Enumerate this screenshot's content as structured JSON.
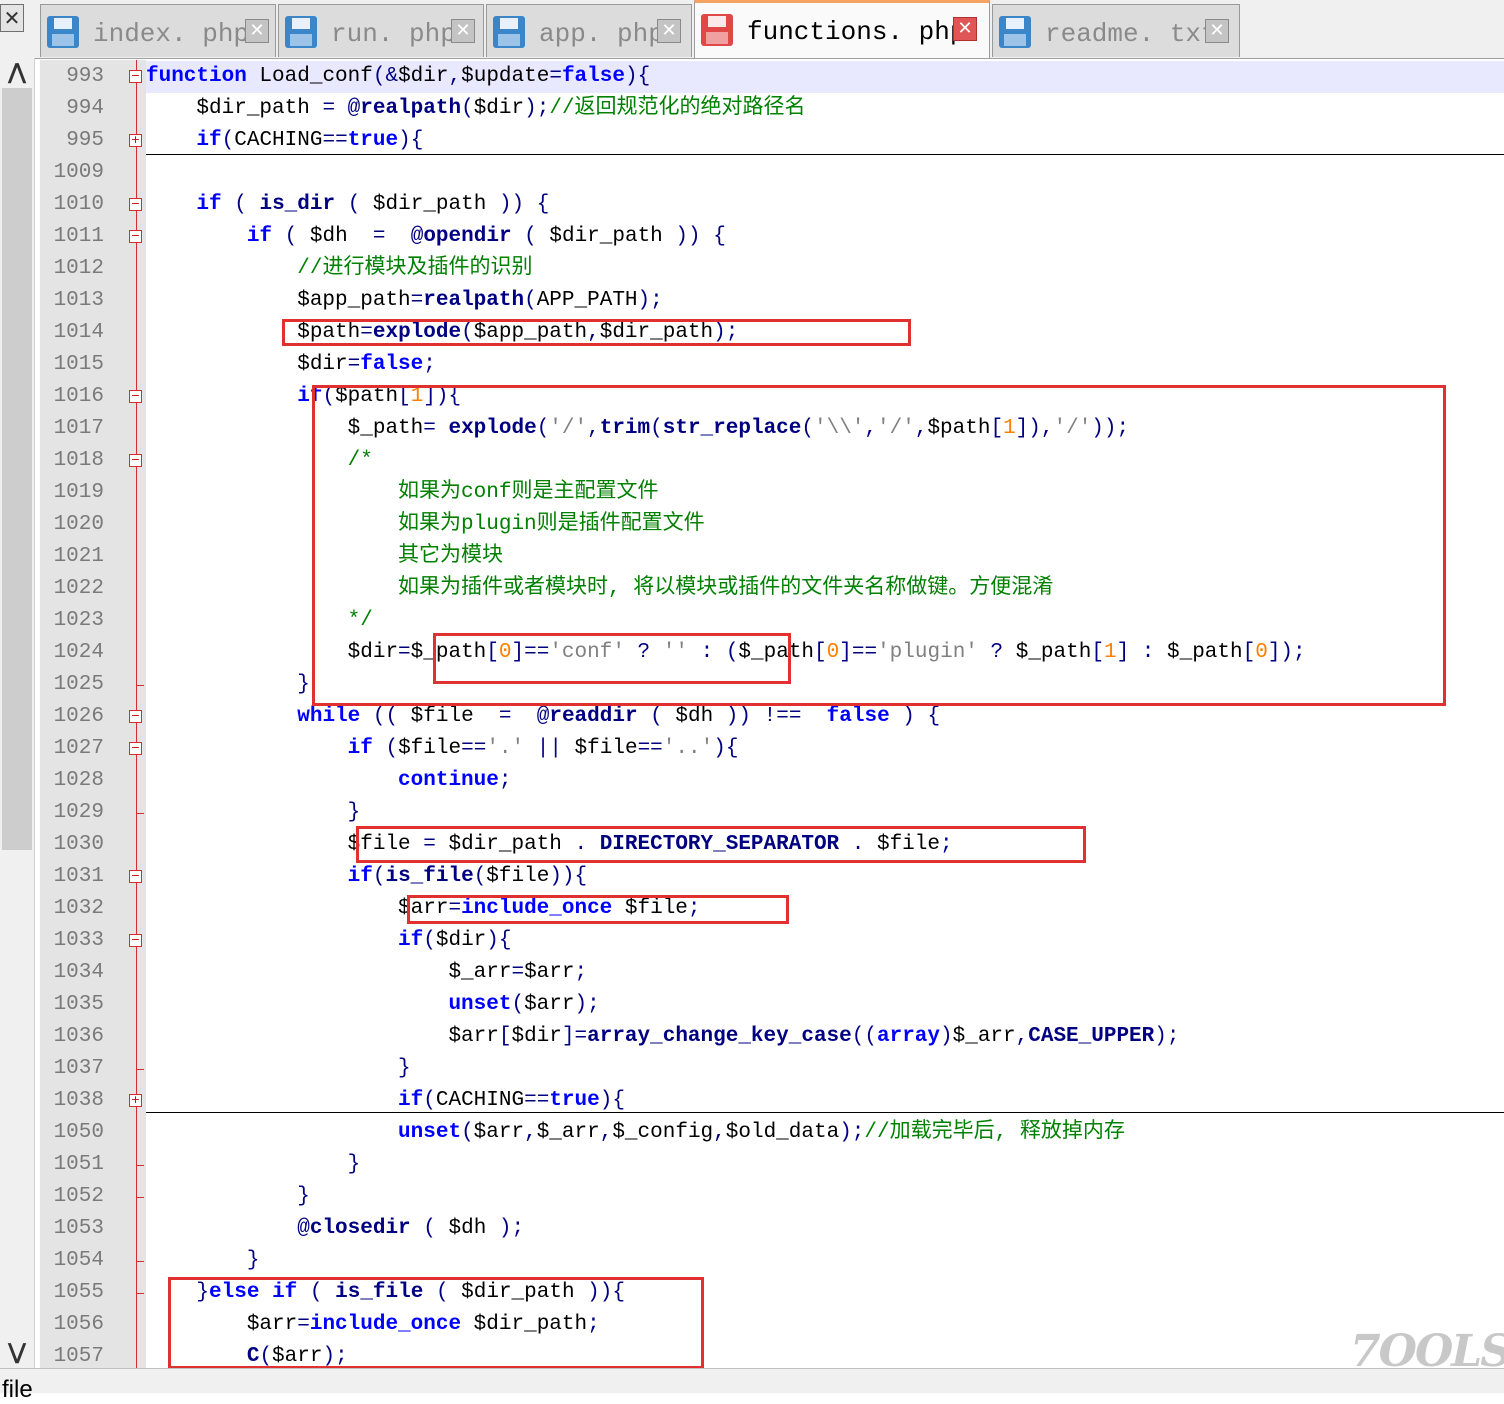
{
  "tabs": [
    {
      "label": "index. php",
      "active": false
    },
    {
      "label": "run. php",
      "active": false
    },
    {
      "label": "app. php",
      "active": false
    },
    {
      "label": "functions. php",
      "active": true
    },
    {
      "label": "readme. txt",
      "active": false
    }
  ],
  "close_glyph": "✕",
  "scroll_up_glyph": "⋀",
  "scroll_down_glyph": "⋁",
  "status_text": "file",
  "watermark": "7OOLS",
  "colors": {
    "keyword": "#0000ff",
    "function": "#000080",
    "comment": "#008000",
    "number": "#ff8000",
    "string": "#808080",
    "annotation": "#e03030"
  },
  "lines": [
    {
      "num": "993",
      "fold": "box",
      "tokens": [
        [
          "k",
          "function"
        ],
        [
          "v",
          " Load_conf"
        ],
        [
          "o",
          "(&"
        ],
        [
          "v",
          "$dir"
        ],
        [
          "o",
          ","
        ],
        [
          "v",
          "$update"
        ],
        [
          "o",
          "="
        ],
        [
          "k",
          "false"
        ],
        [
          "o",
          ")"
        ],
        [
          "o",
          "{"
        ]
      ]
    },
    {
      "num": "994",
      "tokens": [
        [
          "v",
          "    $dir_path "
        ],
        [
          "o",
          "="
        ],
        [
          "v",
          " "
        ],
        [
          "o",
          "@"
        ],
        [
          "f",
          "realpath"
        ],
        [
          "o",
          "("
        ],
        [
          "v",
          "$dir"
        ],
        [
          "o",
          ");"
        ],
        [
          "c",
          "//返回规范化的绝对路径名"
        ]
      ]
    },
    {
      "num": "995",
      "fold": "plus",
      "tokens": [
        [
          "v",
          "    "
        ],
        [
          "k",
          "if"
        ],
        [
          "o",
          "("
        ],
        [
          "v",
          "CACHING"
        ],
        [
          "o",
          "=="
        ],
        [
          "k",
          "true"
        ],
        [
          "o",
          ")"
        ],
        [
          "o",
          "{"
        ]
      ]
    },
    {
      "num": "1009",
      "tokens": []
    },
    {
      "num": "1010",
      "fold": "box",
      "tokens": [
        [
          "v",
          "    "
        ],
        [
          "k",
          "if"
        ],
        [
          "v",
          " "
        ],
        [
          "o",
          "("
        ],
        [
          "v",
          " "
        ],
        [
          "f",
          "is_dir"
        ],
        [
          "v",
          " "
        ],
        [
          "o",
          "("
        ],
        [
          "v",
          " $dir_path "
        ],
        [
          "o",
          "))"
        ],
        [
          "v",
          " "
        ],
        [
          "o",
          "{"
        ]
      ]
    },
    {
      "num": "1011",
      "fold": "box",
      "tokens": [
        [
          "v",
          "        "
        ],
        [
          "k",
          "if"
        ],
        [
          "v",
          " "
        ],
        [
          "o",
          "("
        ],
        [
          "v",
          " $dh  "
        ],
        [
          "o",
          "="
        ],
        [
          "v",
          "  "
        ],
        [
          "o",
          "@"
        ],
        [
          "f",
          "opendir"
        ],
        [
          "v",
          " "
        ],
        [
          "o",
          "("
        ],
        [
          "v",
          " $dir_path "
        ],
        [
          "o",
          "))"
        ],
        [
          "v",
          " "
        ],
        [
          "o",
          "{"
        ]
      ]
    },
    {
      "num": "1012",
      "tokens": [
        [
          "v",
          "            "
        ],
        [
          "c",
          "//进行模块及插件的识别"
        ]
      ]
    },
    {
      "num": "1013",
      "tokens": [
        [
          "v",
          "            $app_path"
        ],
        [
          "o",
          "="
        ],
        [
          "f",
          "realpath"
        ],
        [
          "o",
          "("
        ],
        [
          "v",
          "APP_PATH"
        ],
        [
          "o",
          ");"
        ]
      ]
    },
    {
      "num": "1014",
      "tokens": [
        [
          "v",
          "            $path"
        ],
        [
          "o",
          "="
        ],
        [
          "f",
          "explode"
        ],
        [
          "o",
          "("
        ],
        [
          "v",
          "$app_path"
        ],
        [
          "o",
          ","
        ],
        [
          "v",
          "$dir_path"
        ],
        [
          "o",
          ");"
        ]
      ]
    },
    {
      "num": "1015",
      "tokens": [
        [
          "v",
          "            $dir"
        ],
        [
          "o",
          "="
        ],
        [
          "k",
          "false"
        ],
        [
          "o",
          ";"
        ]
      ]
    },
    {
      "num": "1016",
      "fold": "box",
      "tokens": [
        [
          "v",
          "            "
        ],
        [
          "k",
          "if"
        ],
        [
          "o",
          "("
        ],
        [
          "v",
          "$path"
        ],
        [
          "o",
          "["
        ],
        [
          "n",
          "1"
        ],
        [
          "o",
          "])"
        ],
        [
          "o",
          "{"
        ]
      ]
    },
    {
      "num": "1017",
      "tokens": [
        [
          "v",
          "                $_path"
        ],
        [
          "o",
          "="
        ],
        [
          "v",
          " "
        ],
        [
          "f",
          "explode"
        ],
        [
          "o",
          "("
        ],
        [
          "s",
          "'/'"
        ],
        [
          "o",
          ","
        ],
        [
          "f",
          "trim"
        ],
        [
          "o",
          "("
        ],
        [
          "f",
          "str_replace"
        ],
        [
          "o",
          "("
        ],
        [
          "s",
          "'\\\\'"
        ],
        [
          "o",
          ","
        ],
        [
          "s",
          "'/'"
        ],
        [
          "o",
          ","
        ],
        [
          "v",
          "$path"
        ],
        [
          "o",
          "["
        ],
        [
          "n",
          "1"
        ],
        [
          "o",
          "]),"
        ],
        [
          "s",
          "'/'"
        ],
        [
          "o",
          "));"
        ]
      ]
    },
    {
      "num": "1018",
      "fold": "box",
      "tokens": [
        [
          "v",
          "                "
        ],
        [
          "c",
          "/*"
        ]
      ]
    },
    {
      "num": "1019",
      "tokens": [
        [
          "c",
          "                    如果为conf则是主配置文件"
        ]
      ]
    },
    {
      "num": "1020",
      "tokens": [
        [
          "c",
          "                    如果为plugin则是插件配置文件"
        ]
      ]
    },
    {
      "num": "1021",
      "tokens": [
        [
          "c",
          "                    其它为模块"
        ]
      ]
    },
    {
      "num": "1022",
      "tokens": [
        [
          "c",
          "                    如果为插件或者模块时, 将以模块或插件的文件夹名称做键。方便混淆"
        ]
      ]
    },
    {
      "num": "1023",
      "tokens": [
        [
          "c",
          "                */"
        ]
      ]
    },
    {
      "num": "1024",
      "tokens": [
        [
          "v",
          "                $dir"
        ],
        [
          "o",
          "="
        ],
        [
          "v",
          "$_path"
        ],
        [
          "o",
          "["
        ],
        [
          "n",
          "0"
        ],
        [
          "o",
          "]=="
        ],
        [
          "s",
          "'conf'"
        ],
        [
          "v",
          " "
        ],
        [
          "o",
          "?"
        ],
        [
          "v",
          " "
        ],
        [
          "s",
          "''"
        ],
        [
          "v",
          " "
        ],
        [
          "o",
          ":"
        ],
        [
          "v",
          " "
        ],
        [
          "o",
          "("
        ],
        [
          "v",
          "$_path"
        ],
        [
          "o",
          "["
        ],
        [
          "n",
          "0"
        ],
        [
          "o",
          "]=="
        ],
        [
          "s",
          "'plugin'"
        ],
        [
          "v",
          " "
        ],
        [
          "o",
          "?"
        ],
        [
          "v",
          " $_path"
        ],
        [
          "o",
          "["
        ],
        [
          "n",
          "1"
        ],
        [
          "o",
          "]"
        ],
        [
          "v",
          " "
        ],
        [
          "o",
          ":"
        ],
        [
          "v",
          " $_path"
        ],
        [
          "o",
          "["
        ],
        [
          "n",
          "0"
        ],
        [
          "o",
          "]);"
        ]
      ]
    },
    {
      "num": "1025",
      "fold": "tick",
      "tokens": [
        [
          "v",
          "            "
        ],
        [
          "o",
          "}"
        ]
      ]
    },
    {
      "num": "1026",
      "fold": "box",
      "tokens": [
        [
          "v",
          "            "
        ],
        [
          "k",
          "while"
        ],
        [
          "v",
          " "
        ],
        [
          "o",
          "(("
        ],
        [
          "v",
          " $file  "
        ],
        [
          "o",
          "="
        ],
        [
          "v",
          "  "
        ],
        [
          "o",
          "@"
        ],
        [
          "f",
          "readdir"
        ],
        [
          "v",
          " "
        ],
        [
          "o",
          "("
        ],
        [
          "v",
          " $dh "
        ],
        [
          "o",
          "))"
        ],
        [
          "v",
          " "
        ],
        [
          "o",
          "!=="
        ],
        [
          "v",
          "  "
        ],
        [
          "k",
          "false"
        ],
        [
          "v",
          " "
        ],
        [
          "o",
          ")"
        ],
        [
          "v",
          " "
        ],
        [
          "o",
          "{"
        ]
      ]
    },
    {
      "num": "1027",
      "fold": "box",
      "tokens": [
        [
          "v",
          "                "
        ],
        [
          "k",
          "if"
        ],
        [
          "v",
          " "
        ],
        [
          "o",
          "("
        ],
        [
          "v",
          "$file"
        ],
        [
          "o",
          "=="
        ],
        [
          "s",
          "'.'"
        ],
        [
          "v",
          " "
        ],
        [
          "o",
          "||"
        ],
        [
          "v",
          " $file"
        ],
        [
          "o",
          "=="
        ],
        [
          "s",
          "'..'"
        ],
        [
          "o",
          ")"
        ],
        [
          "o",
          "{"
        ]
      ]
    },
    {
      "num": "1028",
      "tokens": [
        [
          "v",
          "                    "
        ],
        [
          "k",
          "continue"
        ],
        [
          "o",
          ";"
        ]
      ]
    },
    {
      "num": "1029",
      "fold": "tick",
      "tokens": [
        [
          "v",
          "                "
        ],
        [
          "o",
          "}"
        ]
      ]
    },
    {
      "num": "1030",
      "tokens": [
        [
          "v",
          "                $file "
        ],
        [
          "o",
          "="
        ],
        [
          "v",
          " $dir_path "
        ],
        [
          "o",
          "."
        ],
        [
          "v",
          " "
        ],
        [
          "f",
          "DIRECTORY_SEPARATOR"
        ],
        [
          "v",
          " "
        ],
        [
          "o",
          "."
        ],
        [
          "v",
          " $file"
        ],
        [
          "o",
          ";"
        ]
      ]
    },
    {
      "num": "1031",
      "fold": "box",
      "tokens": [
        [
          "v",
          "                "
        ],
        [
          "k",
          "if"
        ],
        [
          "o",
          "("
        ],
        [
          "f",
          "is_file"
        ],
        [
          "o",
          "("
        ],
        [
          "v",
          "$file"
        ],
        [
          "o",
          "))"
        ],
        [
          "o",
          "{"
        ]
      ]
    },
    {
      "num": "1032",
      "tokens": [
        [
          "v",
          "                    $arr"
        ],
        [
          "o",
          "="
        ],
        [
          "k",
          "include_once"
        ],
        [
          "v",
          " $file"
        ],
        [
          "o",
          ";"
        ]
      ]
    },
    {
      "num": "1033",
      "fold": "box",
      "tokens": [
        [
          "v",
          "                    "
        ],
        [
          "k",
          "if"
        ],
        [
          "o",
          "("
        ],
        [
          "v",
          "$dir"
        ],
        [
          "o",
          ")"
        ],
        [
          "o",
          "{"
        ]
      ]
    },
    {
      "num": "1034",
      "tokens": [
        [
          "v",
          "                        $_arr"
        ],
        [
          "o",
          "="
        ],
        [
          "v",
          "$arr"
        ],
        [
          "o",
          ";"
        ]
      ]
    },
    {
      "num": "1035",
      "tokens": [
        [
          "v",
          "                        "
        ],
        [
          "k",
          "unset"
        ],
        [
          "o",
          "("
        ],
        [
          "v",
          "$arr"
        ],
        [
          "o",
          ");"
        ]
      ]
    },
    {
      "num": "1036",
      "tokens": [
        [
          "v",
          "                        $arr"
        ],
        [
          "o",
          "["
        ],
        [
          "v",
          "$dir"
        ],
        [
          "o",
          "]="
        ],
        [
          "f",
          "array_change_key_case"
        ],
        [
          "o",
          "(("
        ],
        [
          "k",
          "array"
        ],
        [
          "o",
          ")"
        ],
        [
          "v",
          "$_arr"
        ],
        [
          "o",
          ","
        ],
        [
          "f",
          "CASE_UPPER"
        ],
        [
          "o",
          ");"
        ]
      ]
    },
    {
      "num": "1037",
      "fold": "tick",
      "tokens": [
        [
          "v",
          "                    "
        ],
        [
          "o",
          "}"
        ]
      ]
    },
    {
      "num": "1038",
      "fold": "plus",
      "tokens": [
        [
          "v",
          "                    "
        ],
        [
          "k",
          "if"
        ],
        [
          "o",
          "("
        ],
        [
          "v",
          "CACHING"
        ],
        [
          "o",
          "=="
        ],
        [
          "k",
          "true"
        ],
        [
          "o",
          ")"
        ],
        [
          "o",
          "{"
        ]
      ]
    },
    {
      "num": "1050",
      "tokens": [
        [
          "v",
          "                    "
        ],
        [
          "k",
          "unset"
        ],
        [
          "o",
          "("
        ],
        [
          "v",
          "$arr"
        ],
        [
          "o",
          ","
        ],
        [
          "v",
          "$_arr"
        ],
        [
          "o",
          ","
        ],
        [
          "v",
          "$_config"
        ],
        [
          "o",
          ","
        ],
        [
          "v",
          "$old_data"
        ],
        [
          "o",
          ");"
        ],
        [
          "c",
          "//加载完毕后, 释放掉内存"
        ]
      ]
    },
    {
      "num": "1051",
      "fold": "tick",
      "tokens": [
        [
          "v",
          "                "
        ],
        [
          "o",
          "}"
        ]
      ]
    },
    {
      "num": "1052",
      "fold": "tick",
      "tokens": [
        [
          "v",
          "            "
        ],
        [
          "o",
          "}"
        ]
      ]
    },
    {
      "num": "1053",
      "tokens": [
        [
          "v",
          "            "
        ],
        [
          "o",
          "@"
        ],
        [
          "f",
          "closedir"
        ],
        [
          "v",
          " "
        ],
        [
          "o",
          "("
        ],
        [
          "v",
          " $dh "
        ],
        [
          "o",
          ");"
        ]
      ]
    },
    {
      "num": "1054",
      "fold": "tick",
      "tokens": [
        [
          "v",
          "        "
        ],
        [
          "o",
          "}"
        ]
      ]
    },
    {
      "num": "1055",
      "fold": "tick",
      "tokens": [
        [
          "v",
          "    "
        ],
        [
          "o",
          "}"
        ],
        [
          "k",
          "else"
        ],
        [
          "v",
          " "
        ],
        [
          "k",
          "if"
        ],
        [
          "v",
          " "
        ],
        [
          "o",
          "("
        ],
        [
          "v",
          " "
        ],
        [
          "f",
          "is_file"
        ],
        [
          "v",
          " "
        ],
        [
          "o",
          "("
        ],
        [
          "v",
          " $dir_path "
        ],
        [
          "o",
          "))"
        ],
        [
          "o",
          "{"
        ]
      ]
    },
    {
      "num": "1056",
      "tokens": [
        [
          "v",
          "        $arr"
        ],
        [
          "o",
          "="
        ],
        [
          "k",
          "include_once"
        ],
        [
          "v",
          " $dir_path"
        ],
        [
          "o",
          ";"
        ]
      ]
    },
    {
      "num": "1057",
      "tokens": [
        [
          "v",
          "        "
        ],
        [
          "f",
          "C"
        ],
        [
          "o",
          "("
        ],
        [
          "v",
          "$arr"
        ],
        [
          "o",
          ");"
        ]
      ]
    }
  ]
}
